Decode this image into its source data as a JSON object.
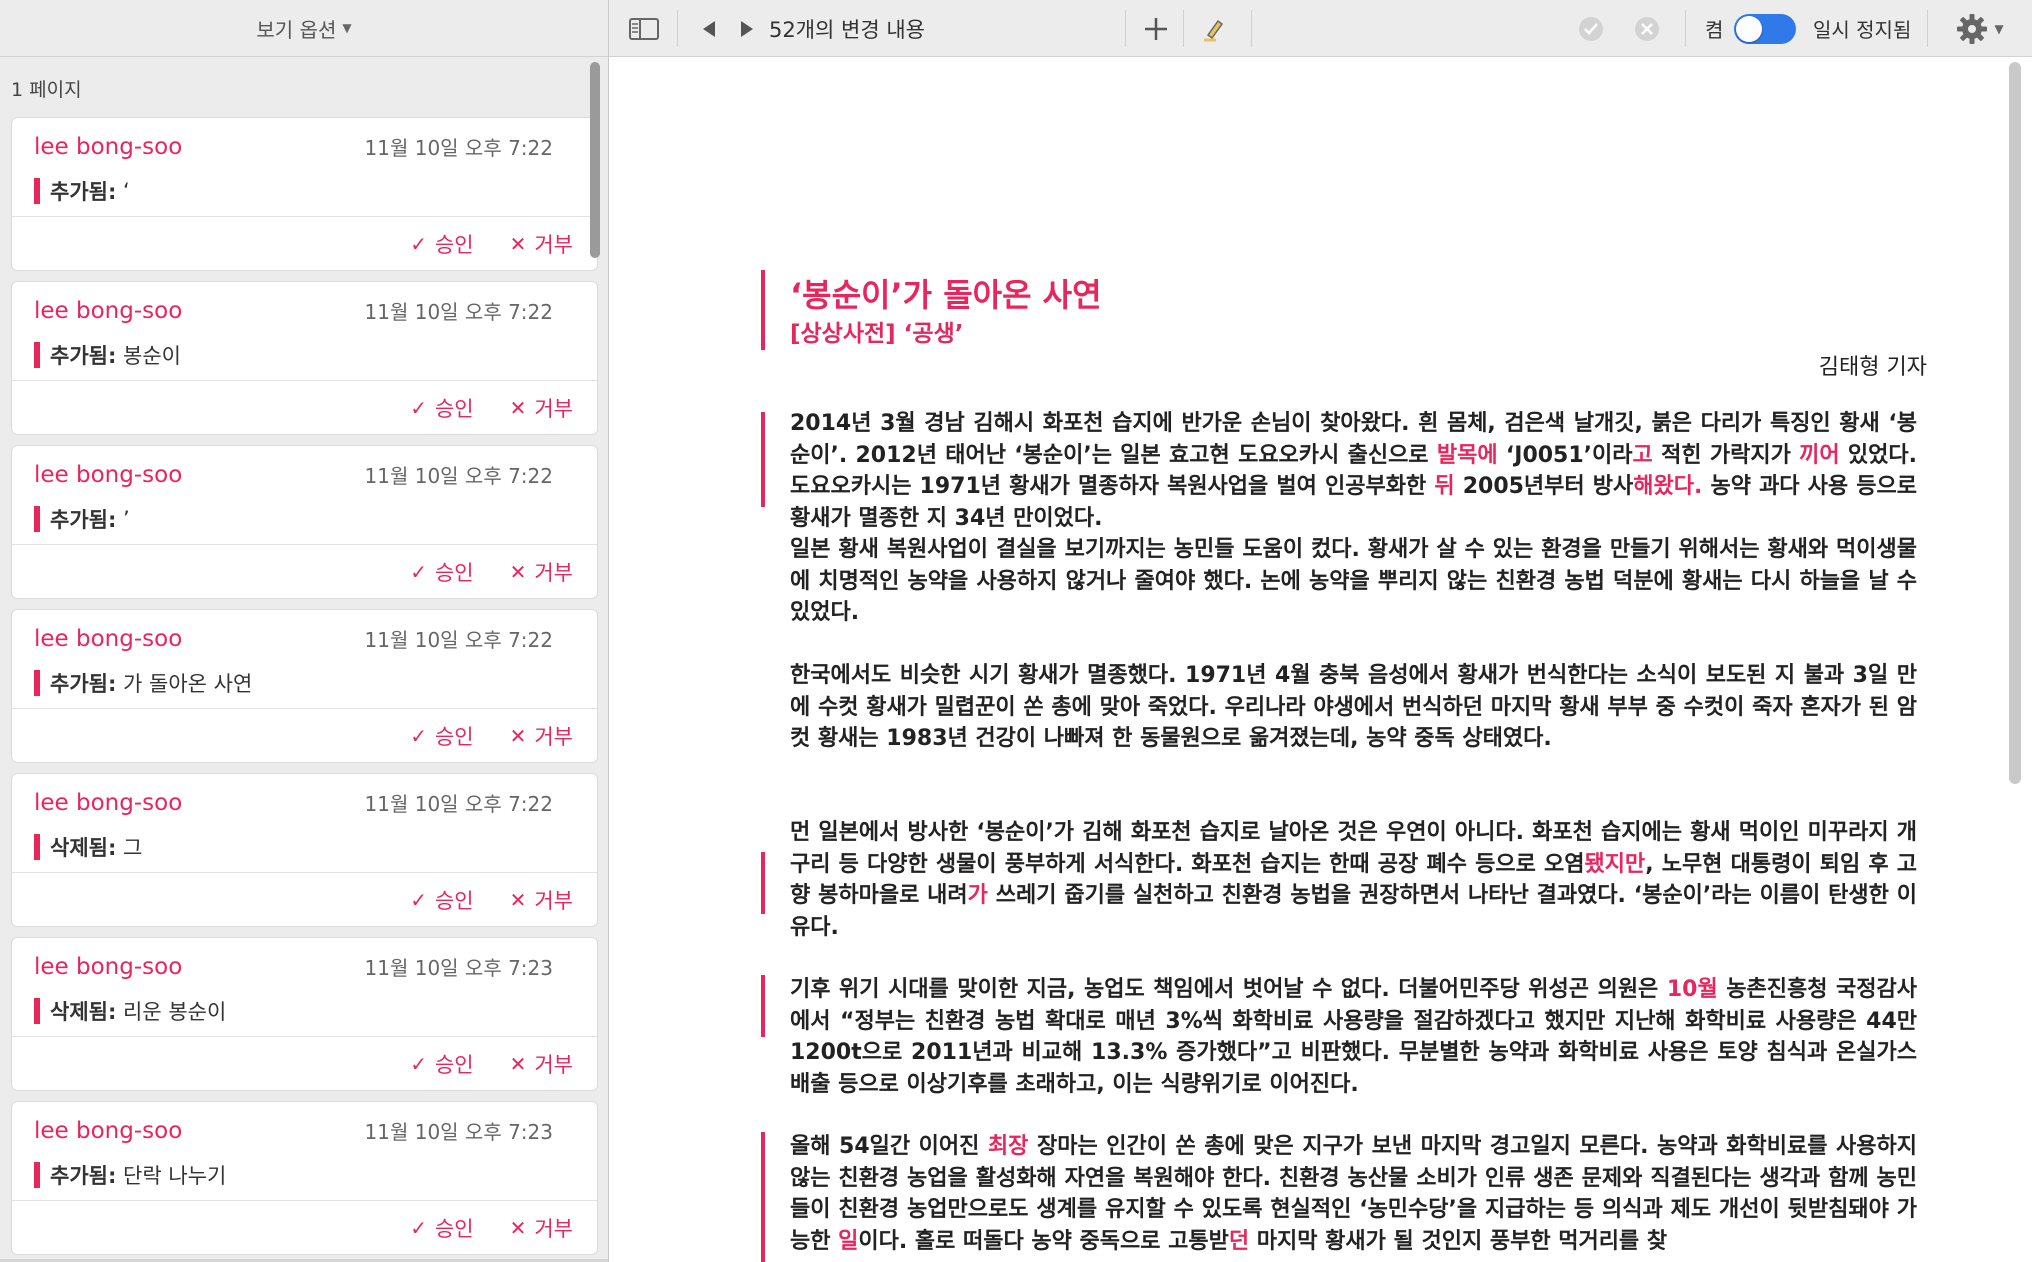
{
  "sidebar": {
    "view_options": "보기 옵션",
    "page_label": "1 페이지",
    "cards": [
      {
        "author": "lee bong-soo",
        "time": "11월 10일 오후 7:22",
        "kind": "추가됨:",
        "text": " ‘",
        "accept": "승인",
        "reject": "거부"
      },
      {
        "author": "lee bong-soo",
        "time": "11월 10일 오후 7:22",
        "kind": "추가됨:",
        "text": " 봉순이",
        "accept": "승인",
        "reject": "거부"
      },
      {
        "author": "lee bong-soo",
        "time": "11월 10일 오후 7:22",
        "kind": "추가됨:",
        "text": " ’",
        "accept": "승인",
        "reject": "거부"
      },
      {
        "author": "lee bong-soo",
        "time": "11월 10일 오후 7:22",
        "kind": "추가됨:",
        "text": " 가 돌아온 사연",
        "accept": "승인",
        "reject": "거부"
      },
      {
        "author": "lee bong-soo",
        "time": "11월 10일 오후 7:22",
        "kind": "삭제됨:",
        "text": " 그",
        "accept": "승인",
        "reject": "거부"
      },
      {
        "author": "lee bong-soo",
        "time": "11월 10일 오후 7:23",
        "kind": "삭제됨:",
        "text": " 리운 봉순이",
        "accept": "승인",
        "reject": "거부"
      },
      {
        "author": "lee bong-soo",
        "time": "11월 10일 오후 7:23",
        "kind": "추가됨:",
        "text": " 단락 나누기",
        "accept": "승인",
        "reject": "거부"
      }
    ]
  },
  "toolbar": {
    "changes_count": "52개의 변경 내용",
    "toggle_label": "켬",
    "toggle_on": true,
    "pause_label": "일시 정지됨"
  },
  "doc": {
    "title": "‘봉순이’가 돌아온 사연",
    "subtitle": "[상상사전] ‘공생’",
    "byline": "김태형 기자",
    "p1": {
      "a": "2014년 3월 경남 김해시 화포천 습지에 반가운 손님이 찾아왔다. 흰 몸체, 검은색 날개깃, 붉은 다리가 특징인 황새 ‘봉순이’. 2012년 태어난 ‘봉순이’는 일본 효고현 도요오카시 출신으로 ",
      "ins1": "발목에",
      "b": " ‘J0051’이라",
      "ins2": "고",
      "c": " 적힌 가락지가 ",
      "ins3": "끼어",
      "d": " 있었다. 도요오카시는 1971년 황새가 멸종하자 복원사업을 벌여 인공부화한 ",
      "ins4": "뒤",
      "e": " 2005년부터 방사",
      "ins5": "해왔다.",
      "f": " 농약 과다 사용 등으로 황새가 멸종한 지 34년 만이었다."
    },
    "p2": "일본 황새 복원사업이 결실을 보기까지는 농민들 도움이 컸다. 황새가 살 수 있는 환경을 만들기 위해서는 황새와 먹이생물에 치명적인 농약을 사용하지 않거나 줄여야 했다. 논에 농약을 뿌리지 않는 친환경 농법 덕분에 황새는 다시 하늘을 날 수 있었다.",
    "p3": "한국에서도 비슷한 시기 황새가 멸종했다. 1971년 4월 충북 음성에서 황새가 번식한다는 소식이 보도된 지 불과 3일 만에 수컷 황새가 밀렵꾼이 쏜 총에 맞아 죽었다. 우리나라 야생에서 번식하던 마지막 황새 부부 중 수컷이 죽자 혼자가 된 암컷 황새는 1983년 건강이 나빠져 한 동물원으로 옮겨졌는데, 농약 중독 상태였다.",
    "p4": {
      "a": "먼 일본에서 방사한 ‘봉순이’가 김해 화포천 습지로 날아온 것은 우연이 아니다. 화포천 습지에는 황새 먹이인 미꾸라지 개구리 등 다양한 생물이 풍부하게 서식한다. 화포천 습지는 한때 공장 폐수 등으로 오염",
      "ins1": "됐지만",
      "b": ", 노무현 대통령이 퇴임 후 고향 봉하마을로 내려",
      "ins2": "가",
      "c": " 쓰레기 줍기를 실천하고 친환경 농법을 권장하면서 나타난 결과였다. ‘봉순이’라는 이름이 탄생한 이유다."
    },
    "p5": {
      "a": "기후 위기 시대를 맞이한 지금, 농업도 책임에서 벗어날 수 없다. 더불어민주당 위성곤 의원은 ",
      "ins1": "10월",
      "b": " 농촌진흥청 국정감사에서 “정부는 친환경 농법 확대로 매년 3%씩 화학비료 사용량을 절감하겠다고 했지만 지난해 화학비료 사용량은 44만1200t으로 2011년과 비교해 13.3% 증가했다”고 비판했다. 무분별한 농약과 화학비료 사용은 토양 침식과 온실가스 배출 등으로 이상기후를 초래하고, 이는 식량위기로 이어진다."
    },
    "p6": {
      "a": "올해 54일간 이어진 ",
      "ins1": "최장",
      "b": " 장마는 인간이 쏜 총에 맞은 지구가 보낸 마지막 경고일지 모른다. 농약과 화학비료를 사용하지 않는 친환경 농업을 활성화해 자연을 복원해야 한다. 친환경 농산물 소비가 인류 생존 문제와 직결된다는 생각과 함께 농민들이 친환경 농업만으로도 생계를 유지할 수 있도록 현실적인 ‘농민수당’을 지급하는 등 의식과 제도 개선이 뒷받침돼야 가능한 ",
      "ins2": "일",
      "c": "이다. 홀로 떠돌다 농약 중독으로 고통받",
      "ins3": "던",
      "d": " 마지막 황새가 될 것인지 풍부한 먹거리를 찾"
    }
  }
}
